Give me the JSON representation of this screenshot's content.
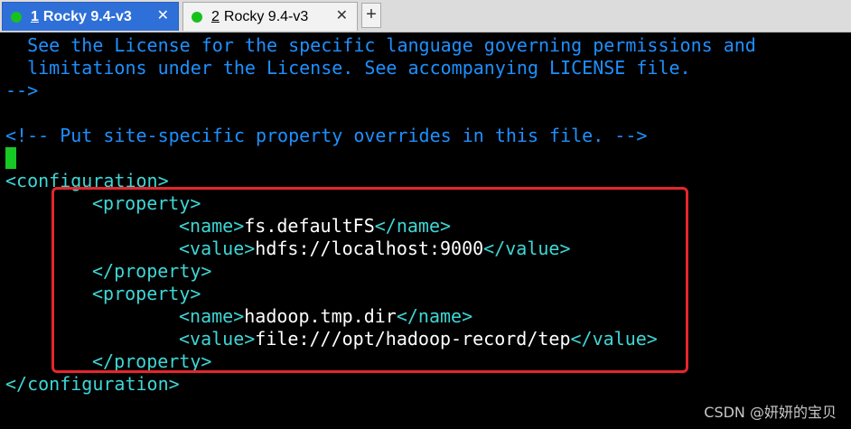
{
  "tabs": [
    {
      "number": "1",
      "title": "Rocky 9.4-v3",
      "close": "✕"
    },
    {
      "number": "2",
      "title": "Rocky 9.4-v3",
      "close": "✕"
    }
  ],
  "new_tab_label": "+",
  "status_color": "#18c11d",
  "terminal": {
    "l1": "  See the License for the specific language governing permissions and",
    "l2": "  limitations under the License. See accompanying LICENSE file.",
    "l3": "-->",
    "l5": "<!-- Put site-specific property overrides in this file. -->",
    "config_open": "<configuration>",
    "p1_open": "<property>",
    "p1_name_open": "<name>",
    "p1_name_val": "fs.defaultFS",
    "p1_name_close": "</name>",
    "p1_value_open": "<value>",
    "p1_value_val": "hdfs://localhost:9000",
    "p1_value_close": "</value>",
    "p1_close": "</property>",
    "p2_open": "<property>",
    "p2_name_open": "<name>",
    "p2_name_val": "hadoop.tmp.dir",
    "p2_name_close": "</name>",
    "p2_value_open": "<value>",
    "p2_value_val": "file:///opt/hadoop-record/tep",
    "p2_value_close": "</value>",
    "p2_close": "</property>",
    "config_close": "</configuration>"
  },
  "watermark": "CSDN @妍妍的宝贝",
  "colors": {
    "comment": "#1e90ff",
    "tag": "#3fd6d6",
    "text": "#ffffff",
    "cursor": "#16c923",
    "highlight": "#e5262a",
    "active_tab": "#2f6fd8"
  }
}
